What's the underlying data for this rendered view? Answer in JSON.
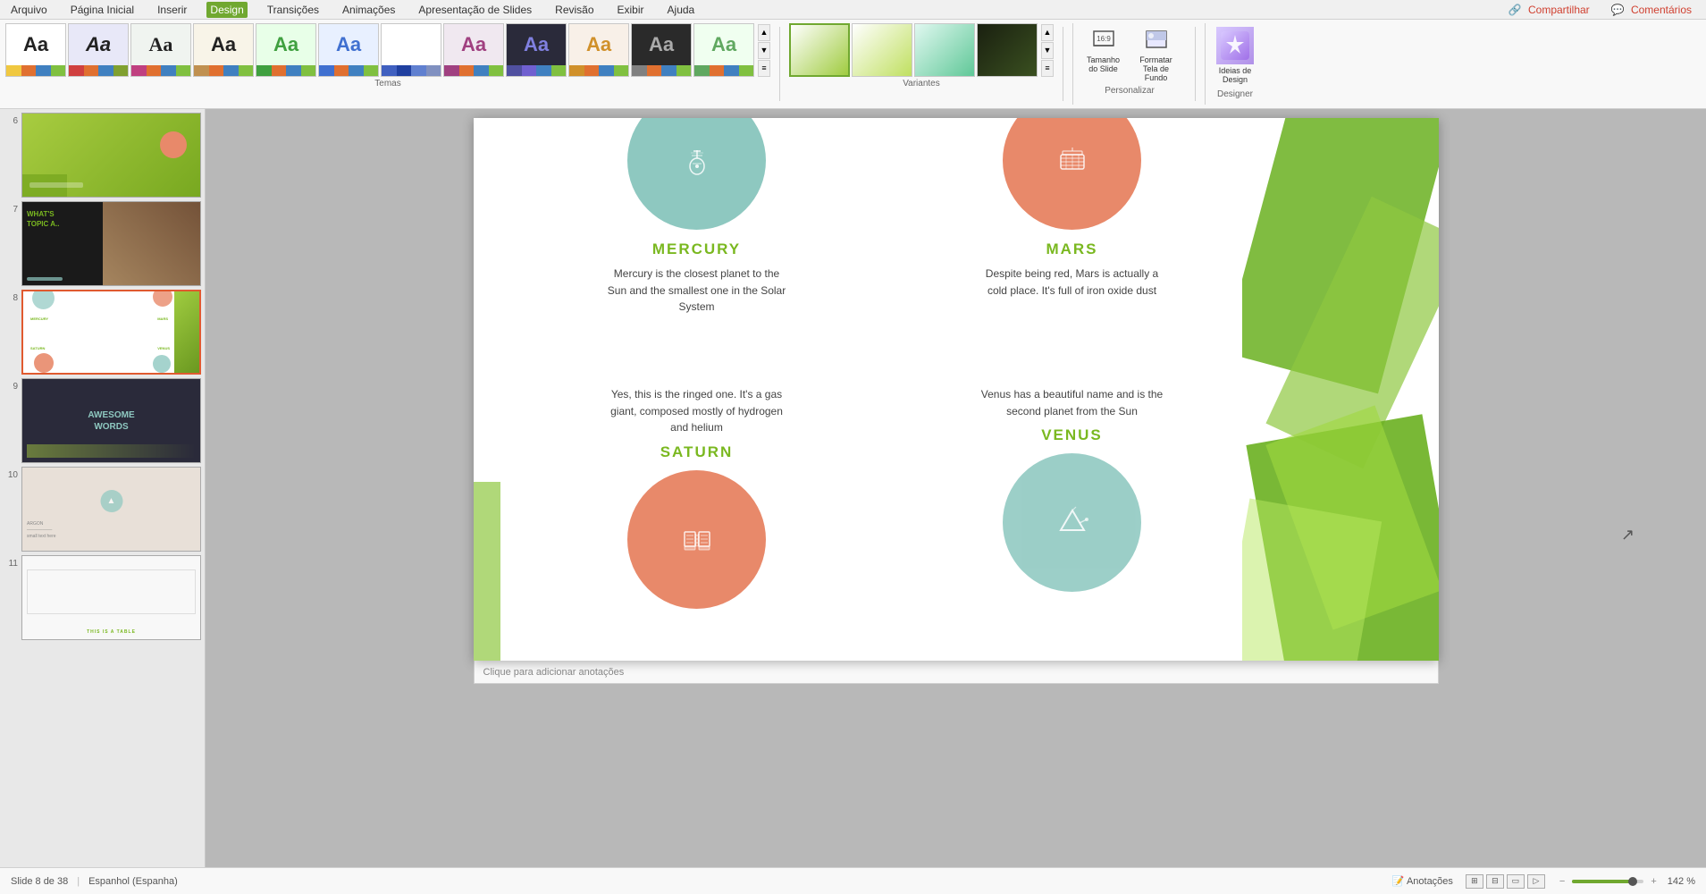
{
  "menubar": {
    "items": [
      "Arquivo",
      "Página Inicial",
      "Inserir",
      "Design",
      "Transições",
      "Animações",
      "Apresentação de Slides",
      "Revisão",
      "Exibir",
      "Ajuda"
    ],
    "active": "Design",
    "right": [
      "Compartilhar",
      "Comentários"
    ]
  },
  "ribbon": {
    "section_themes_label": "Temas",
    "section_variants_label": "Variantes",
    "section_personalizar_label": "Personalizar",
    "section_designer_label": "Designer",
    "themes": [
      {
        "label": "Aa",
        "colors": [
          "#f0c840",
          "#e07030",
          "#4080c0",
          "#80c040"
        ]
      },
      {
        "label": "Aa",
        "colors": [
          "#d04040",
          "#e07030",
          "#4080c0",
          "#80a030"
        ]
      },
      {
        "label": "Aa",
        "colors": [
          "#c04080",
          "#e07030",
          "#4080c0",
          "#80c040"
        ]
      },
      {
        "label": "Aa",
        "colors": [
          "#c09050",
          "#e07030",
          "#4080c0",
          "#80c040"
        ]
      },
      {
        "label": "Aa",
        "colors": [
          "#40a040",
          "#e07030",
          "#4080c0",
          "#80c040"
        ]
      },
      {
        "label": "Aa",
        "colors": [
          "#4070d0",
          "#e07030",
          "#4080c0",
          "#80c040"
        ]
      },
      {
        "label": "Aa",
        "colors": [
          "#4060c0",
          "#2040a0",
          "#6080d0",
          "#8090c0"
        ]
      },
      {
        "label": "Aa",
        "colors": [
          "#a04080",
          "#e07030",
          "#4080c0",
          "#80c040"
        ]
      },
      {
        "label": "Aa",
        "colors": [
          "#5050a0",
          "#7060d0",
          "#4080c0",
          "#80c040"
        ]
      },
      {
        "label": "Aa",
        "colors": [
          "#d0902a",
          "#e07030",
          "#4080c0",
          "#80c040"
        ]
      },
      {
        "label": "Aa",
        "colors": [
          "#808080",
          "#e07030",
          "#4080c0",
          "#80c040"
        ]
      },
      {
        "label": "Aa",
        "colors": [
          "#60a860",
          "#e07030",
          "#4080c0",
          "#80c040"
        ]
      }
    ],
    "variants": [
      {
        "color": "#a0cc40"
      },
      {
        "color": "#c0e060"
      },
      {
        "color": "#60c898"
      },
      {
        "color": "#1a2010"
      }
    ],
    "buttons": {
      "tamanho": "Tamanho\ndo Slide",
      "formatar": "Formatar\nTela de\nFundo",
      "tela": "Tela\nde Fundo",
      "ideias": "Ideias de\nDesign"
    }
  },
  "slides": [
    {
      "num": "6",
      "type": "green"
    },
    {
      "num": "7",
      "type": "dark"
    },
    {
      "num": "8",
      "type": "mixed",
      "active": true
    },
    {
      "num": "9",
      "type": "dark2"
    },
    {
      "num": "10",
      "type": "beige"
    },
    {
      "num": "11",
      "type": "white"
    }
  ],
  "slide": {
    "planets": [
      {
        "name": "MERCURY",
        "desc": "Mercury is the closest planet to the Sun and the smallest one in the Solar System",
        "position": "top-left",
        "circle_color": "teal",
        "icon": "♫"
      },
      {
        "name": "MARS",
        "desc": "Despite being red, Mars is actually a cold place. It's full of iron oxide dust",
        "position": "top-right",
        "circle_color": "salmon",
        "icon": "⊞"
      },
      {
        "name": "SATURN",
        "desc": "Yes, this is the ringed one. It's a gas giant, composed mostly of hydrogen and helium",
        "position": "bottom-left",
        "circle_color": "salmon2",
        "icon": "🎹"
      },
      {
        "name": "VENUS",
        "desc": "Venus has a beautiful name and is the second planet from the Sun",
        "position": "bottom-right",
        "circle_color": "teal2",
        "icon": "✦"
      }
    ]
  },
  "bottom": {
    "slide_info": "Slide 8 de 38",
    "language": "Espanhol (Espanha)",
    "notes_label": "Anotações",
    "zoom_pct": "142 %",
    "note_placeholder": "Clique para adicionar anotações"
  },
  "colors": {
    "green_accent": "#7ab820",
    "salmon": "#e8896a",
    "teal": "#8ec8c0",
    "menu_active_bg": "#70a830"
  }
}
